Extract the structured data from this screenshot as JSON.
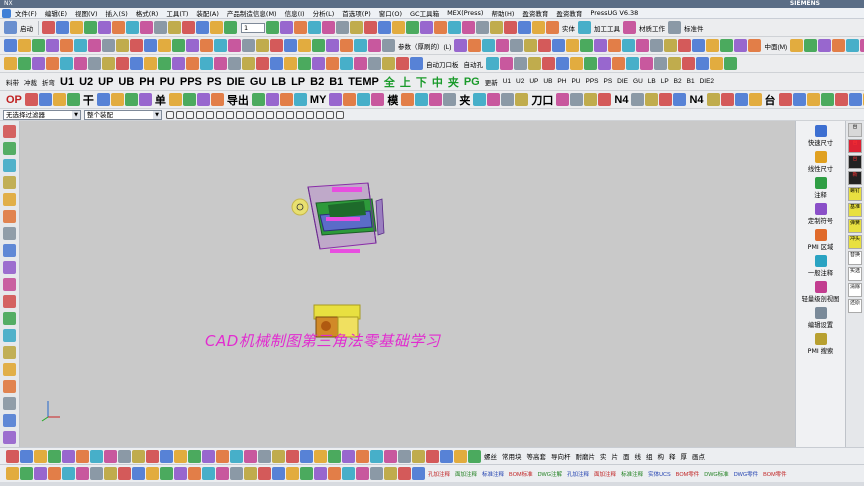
{
  "window": {
    "title": "NX",
    "brand": "SIEMENS"
  },
  "menu": [
    "文件(F)",
    "编辑(E)",
    "视图(V)",
    "插入(S)",
    "格式(R)",
    "工具(T)",
    "装配(A)",
    "产品制造信息(M)",
    "信息(I)",
    "分析(L)",
    "首选项(P)",
    "窗口(O)",
    "GC工具箱",
    "MEX(Press)",
    "帮助(H)",
    "盈资教育",
    "盈资教育",
    "PressUG V6.38"
  ],
  "toolbar1": {
    "start_label": "启动",
    "combo_value": "1",
    "labels": [
      "实体",
      "加工工具",
      "材质工作",
      "标准件"
    ]
  },
  "toolbar2": {
    "labels": [
      "参数（厚刷的）(L)",
      "中面(M)",
      "优化中"
    ]
  },
  "toolbar3": {
    "labels": [
      "料带",
      "冲裁",
      "折弯",
      "U1",
      "U2",
      "UP",
      "UB",
      "PH",
      "PU",
      "PPS",
      "PS",
      "DIE",
      "GU",
      "LB",
      "LP",
      "B2",
      "B1",
      "自动刀口板",
      "自动孔",
      "TEMP",
      "全",
      "上",
      "下",
      "中",
      "夹",
      "PG",
      "更新",
      "U1",
      "U2",
      "UP",
      "UB",
      "PH",
      "PU",
      "PPS",
      "PS",
      "DIE",
      "GU",
      "LB",
      "LP",
      "B2",
      "B1",
      "DIE2"
    ]
  },
  "toolbar4": {
    "labels": [
      "OP",
      "干",
      "单",
      "导出",
      "MY",
      "模",
      "夹",
      "刀口",
      "N4",
      "N4",
      "台"
    ]
  },
  "filter": {
    "type_filter": "无选择过滤器",
    "scope": "整个装配"
  },
  "canvas": {
    "caption": "CAD机械制图第三角法零基础学习"
  },
  "right_panel": [
    {
      "label": "快速尺寸",
      "icon": "quick-dimension-icon"
    },
    {
      "label": "线性尺寸",
      "icon": "linear-dimension-icon"
    },
    {
      "label": "注释",
      "icon": "note-icon"
    },
    {
      "label": "定制符号",
      "icon": "custom-symbol-icon"
    },
    {
      "label": "PMI 区域",
      "icon": "pmi-region-icon"
    },
    {
      "label": "一般注释",
      "icon": "general-note-icon"
    },
    {
      "label": "轻量级剖视图",
      "icon": "section-view-icon"
    },
    {
      "label": "编辑设置",
      "icon": "edit-settings-icon"
    },
    {
      "label": "PMI 搜索",
      "icon": "pmi-search-icon"
    }
  ],
  "right_strip": [
    "台",
    "台",
    "台",
    "新",
    "螺钉",
    "基准",
    "弹簧",
    "冲头",
    "替换",
    "实选",
    "清除",
    "还原"
  ],
  "bottom1": {
    "labels": [
      "螺丝",
      "常用块",
      "等高套",
      "导向杆",
      "耐磨片",
      "实",
      "片",
      "面",
      "线",
      "组",
      "构",
      "释",
      "厚",
      "画点"
    ]
  },
  "bottom2": {
    "labels": [
      "孔加注释",
      "面加注释",
      "标准注释",
      "BOM标准",
      "DWG注解",
      "孔加注释",
      "面加注释",
      "标准注释",
      "实体UCS",
      "BOM零件",
      "DWG标准",
      "DWG零件",
      "BOM零件"
    ]
  }
}
